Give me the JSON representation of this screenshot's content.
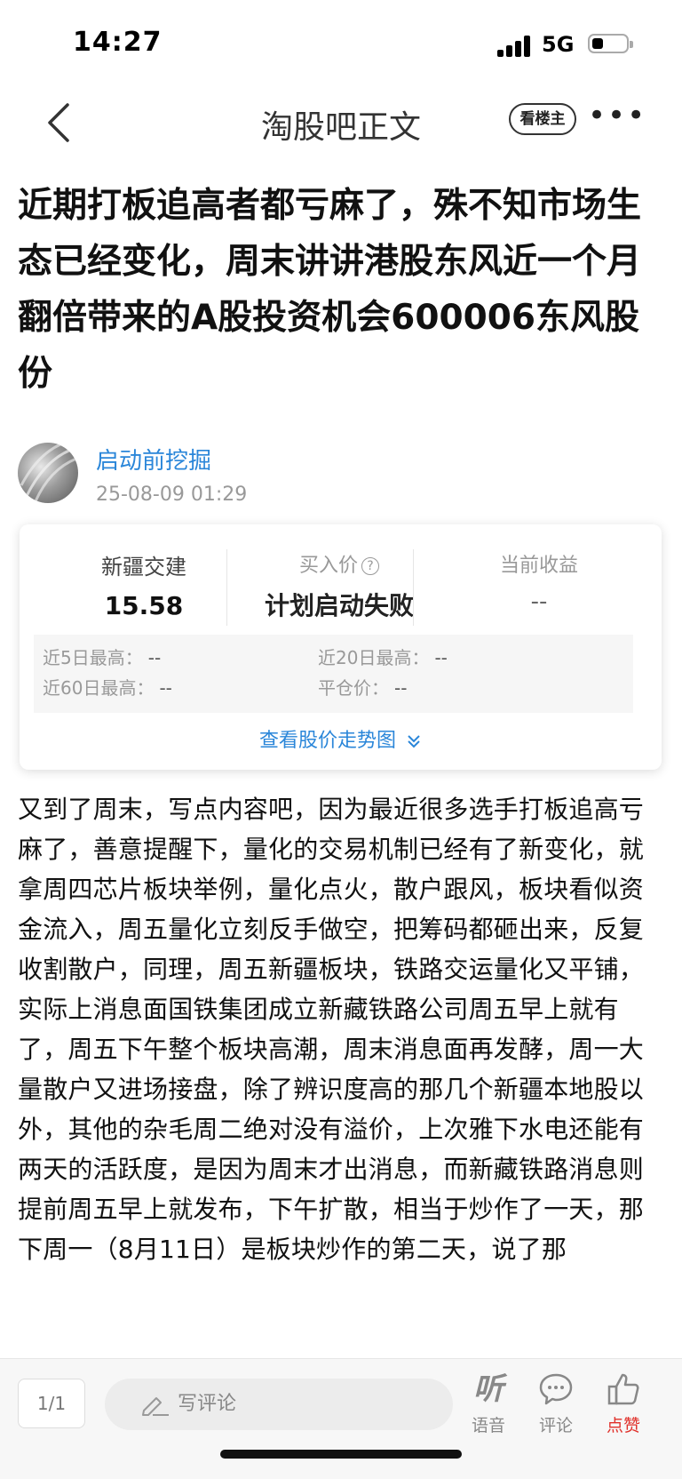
{
  "status": {
    "time": "14:27",
    "network": "5G"
  },
  "nav": {
    "title": "淘股吧正文",
    "owner_label": "看楼主",
    "more_icon": "more-dots-icon"
  },
  "article": {
    "title": "近期打板追高者都亏麻了，殊不知市场生态已经变化，周末讲讲港股东风近一个月翻倍带来的A股投资机会600006东风股份",
    "author": "启动前挖掘",
    "date": "25-08-09 01:29",
    "body": "又到了周末，写点内容吧，因为最近很多选手打板追高亏麻了，善意提醒下，量化的交易机制已经有了新变化，就拿周四芯片板块举例，量化点火，散户跟风，板块看似资金流入，周五量化立刻反手做空，把筹码都砸出来，反复收割散户，同理，周五新疆板块，铁路交运量化又平铺，实际上消息面国铁集团成立新藏铁路公司周五早上就有了，周五下午整个板块高潮，周末消息面再发酵，周一大量散户又进场接盘，除了辨识度高的那几个新疆本地股以外，其他的杂毛周二绝对没有溢价，上次雅下水电还能有两天的活跃度，是因为周末才出消息，而新藏铁路消息则提前周五早上就发布，下午扩散，相当于炒作了一天，那下周一（8月11日）是板块炒作的第二天，说了那"
  },
  "stock_card": {
    "stock_name": "新疆交建",
    "stock_price": "15.58",
    "buy_label": "买入价",
    "buy_value": "计划启动失败",
    "profit_label": "当前收益",
    "profit_value": "--",
    "stats": {
      "high5_label": "近5日最高：",
      "high5_value": "--",
      "high20_label": "近20日最高：",
      "high20_value": "--",
      "high60_label": "近60日最高：",
      "high60_value": "--",
      "close_label": "平仓价：",
      "close_value": "--"
    },
    "trend_link": "查看股价走势图"
  },
  "bottom_bar": {
    "page": "1/1",
    "comment_placeholder": "写评论",
    "listen_label": "语音",
    "listen_glyph": "听",
    "comment_label": "评论",
    "like_label": "点赞"
  },
  "colors": {
    "link": "#2a86d9",
    "like": "#e0302a"
  }
}
